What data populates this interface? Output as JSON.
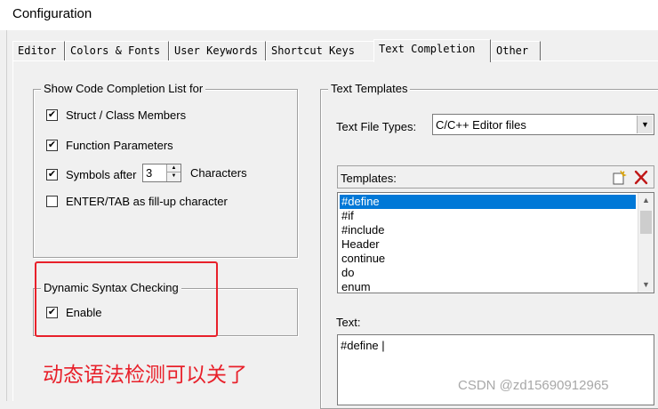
{
  "window": {
    "title": "Configuration"
  },
  "tabs": [
    {
      "label": "Editor",
      "active": false
    },
    {
      "label": "Colors & Fonts",
      "active": false
    },
    {
      "label": "User Keywords",
      "active": false
    },
    {
      "label": "Shortcut Keys",
      "active": false
    },
    {
      "label": "Text Completion",
      "active": true
    },
    {
      "label": "Other",
      "active": false
    }
  ],
  "code_completion": {
    "legend": "Show Code Completion List for",
    "struct_members": {
      "label": "Struct / Class Members",
      "checked": true
    },
    "function_params": {
      "label": "Function Parameters",
      "checked": true
    },
    "symbols_after": {
      "label": "Symbols after",
      "checked": true,
      "value": "3",
      "suffix": "Characters"
    },
    "enter_tab": {
      "label": "ENTER/TAB as fill-up character",
      "checked": false
    }
  },
  "syntax_checking": {
    "legend": "Dynamic Syntax Checking",
    "enable": {
      "label": "Enable",
      "checked": true
    }
  },
  "text_templates": {
    "legend": "Text Templates",
    "file_types_label": "Text File Types:",
    "file_types_value": "C/C++ Editor files",
    "templates_label": "Templates:",
    "templates": [
      "#define",
      "#if",
      "#include",
      "Header",
      "continue",
      "do",
      "enum"
    ],
    "selected_index": 0,
    "text_label": "Text:",
    "text_value": "#define |"
  },
  "annotation": {
    "text": "动态语法检测可以关了",
    "color": "#e8202a"
  },
  "watermark": "CSDN @zd15690912965",
  "icons": {
    "check": "✔",
    "new_template": "new-template-icon",
    "delete_template": "delete-icon",
    "dropdown": "▼",
    "scroll_up": "▲",
    "scroll_down": "▼"
  }
}
